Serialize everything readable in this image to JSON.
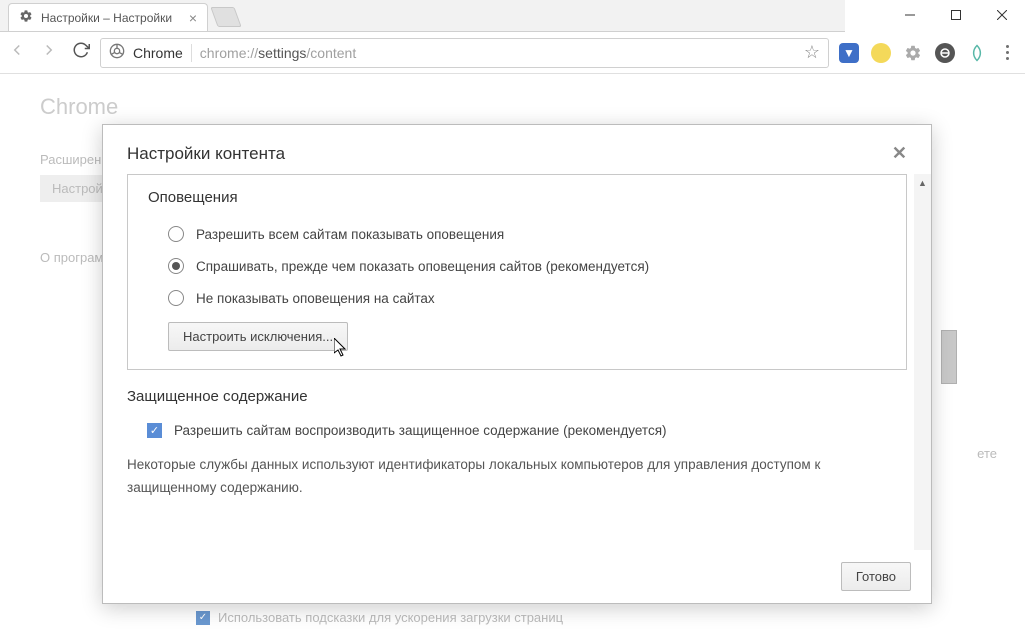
{
  "window": {
    "tab_title": "Настройки – Настройки",
    "omnibox": {
      "scheme_label": "Chrome",
      "url_gray1": "chrome://",
      "url_dark": "settings",
      "url_gray2": "/content"
    }
  },
  "background": {
    "heading": "Chrome",
    "sidebar_extensions": "Расширения",
    "sidebar_settings": "Настройки",
    "sidebar_about": "О программе",
    "right_hint_partial": "ете",
    "bottom_checkbox_label": "Использовать подсказки для ускорения загрузки страниц"
  },
  "modal": {
    "title": "Настройки контента",
    "section_notifications": {
      "title": "Оповещения",
      "opt_allow": "Разрешить всем сайтам показывать оповещения",
      "opt_ask": "Спрашивать, прежде чем показать оповещения сайтов (рекомендуется)",
      "opt_block": "Не показывать оповещения на сайтах",
      "exceptions_btn": "Настроить исключения..."
    },
    "section_protected": {
      "title": "Защищенное содержание",
      "checkbox_label": "Разрешить сайтам воспроизводить защищенное содержание (рекомендуется)",
      "description": "Некоторые службы данных используют идентификаторы локальных компьютеров для управления доступом к защищенному содержанию."
    },
    "done_btn": "Готово"
  }
}
